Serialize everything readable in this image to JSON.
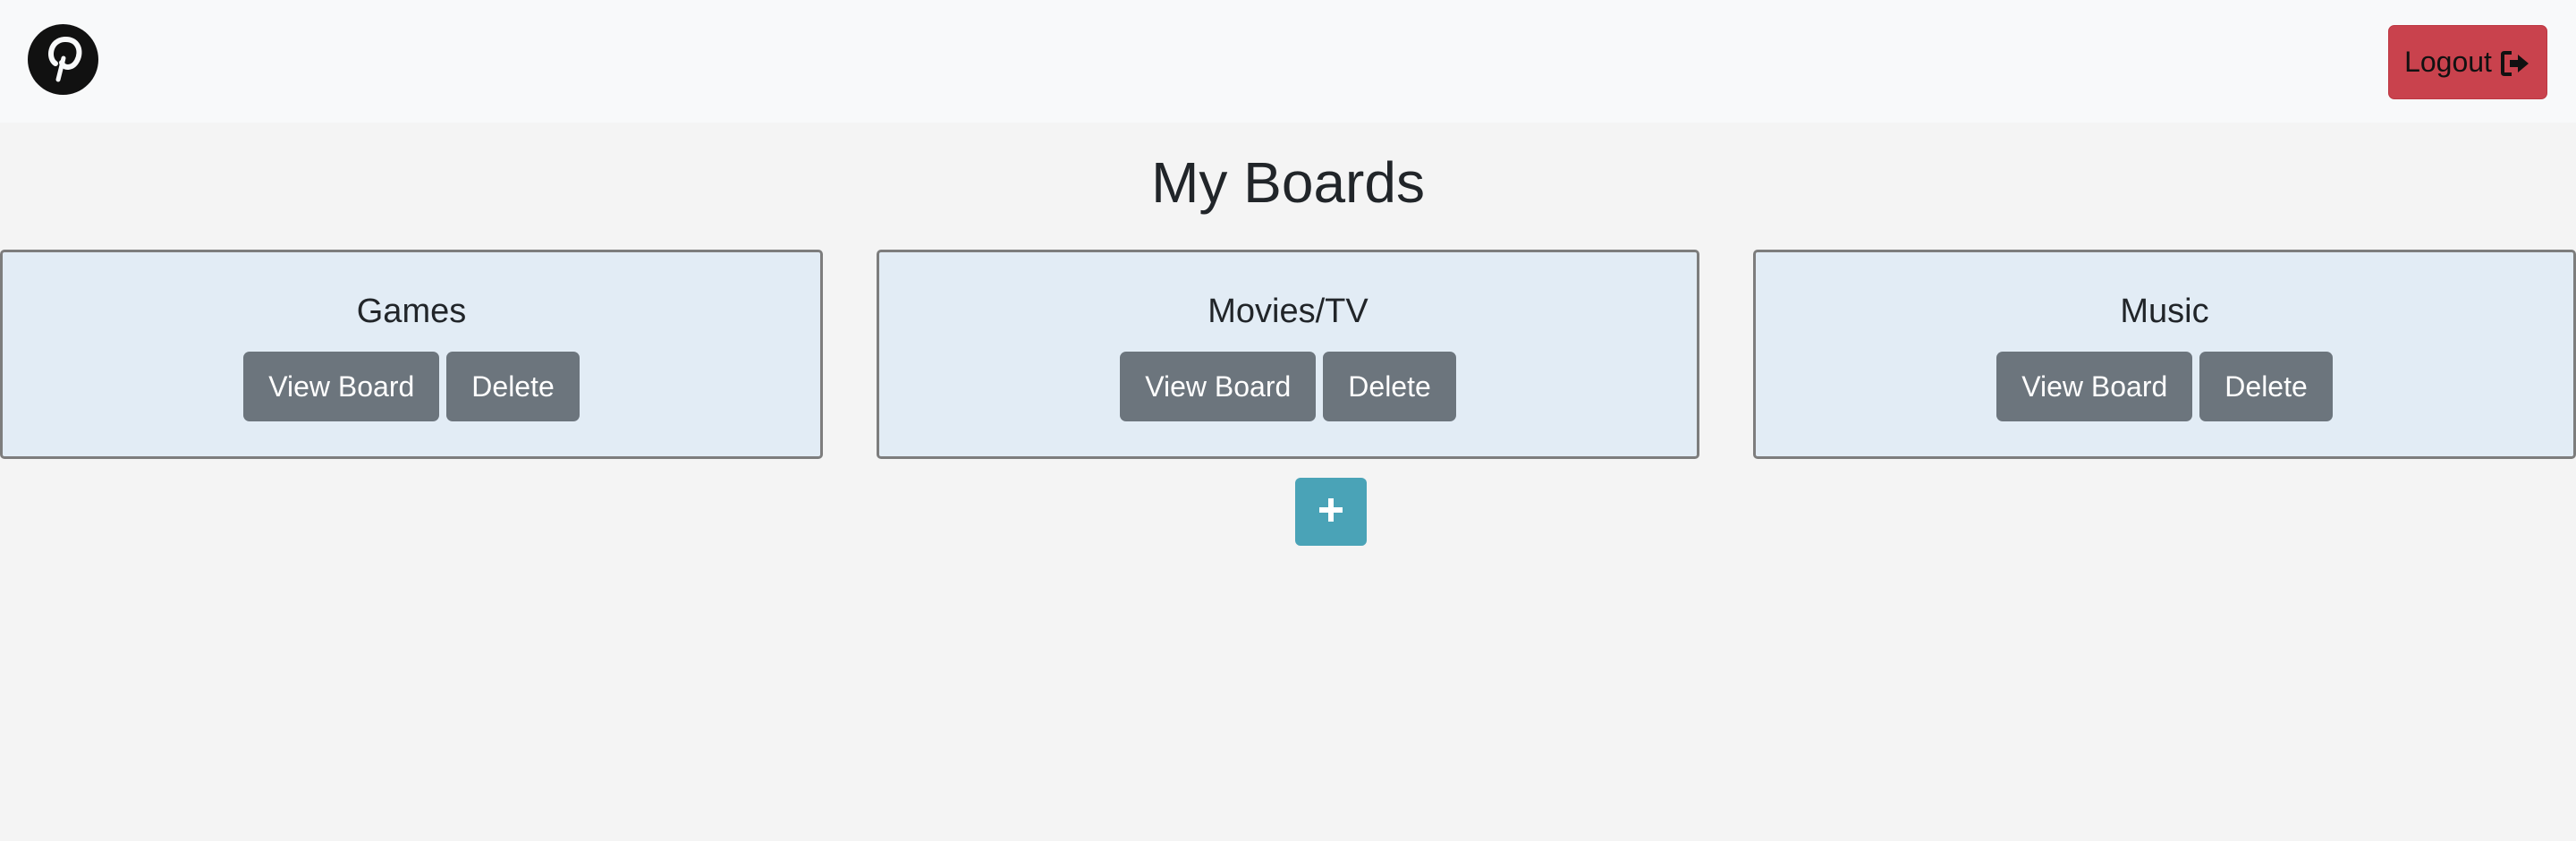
{
  "navbar": {
    "logo_icon": "pinterest-logo-icon",
    "logout_label": "Logout",
    "logout_icon": "sign-out-icon",
    "logout_color": "#c9424d"
  },
  "page": {
    "title": "My Boards"
  },
  "boards": [
    {
      "name": "Games",
      "view_label": "View Board",
      "delete_label": "Delete"
    },
    {
      "name": "Movies/TV",
      "view_label": "View Board",
      "delete_label": "Delete"
    },
    {
      "name": "Music",
      "view_label": "View Board",
      "delete_label": "Delete"
    }
  ],
  "add_board": {
    "icon": "plus-icon",
    "color": "#4aa3b7"
  },
  "colors": {
    "card_bg": "#e2ecf5",
    "button_gray": "#6c757d",
    "page_bg": "#f4f4f4"
  }
}
